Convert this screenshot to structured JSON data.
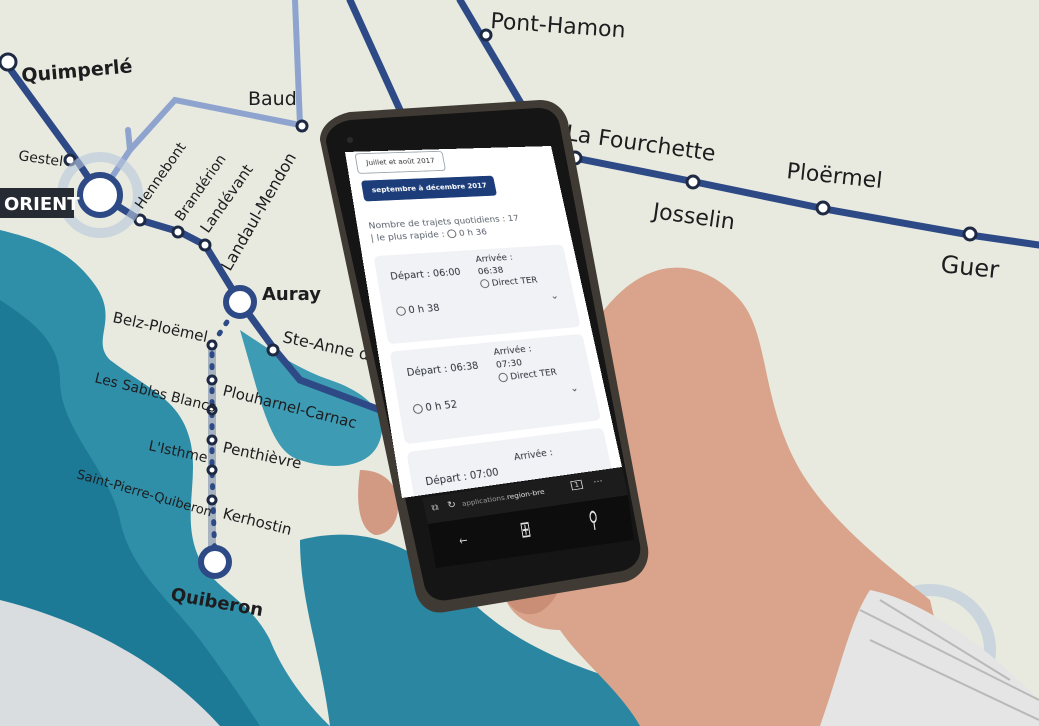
{
  "map": {
    "stations": {
      "pont_hamon": "Pont-Hamon",
      "quimperle": "Quimperlé",
      "baud": "Baud",
      "gestel": "Gestel",
      "hennebont": "Hennebont",
      "branderion": "Brandérion",
      "landevant": "Landévant",
      "landaul_mendon": "Landaul-Mendon",
      "lorient": "ORIENT",
      "auray": "Auray",
      "ste_anne": "Ste-Anne d'A",
      "belz": "Belz-Ploëmel",
      "plouharnel": "Plouharnel-Carnac",
      "les_sables": "Les Sables Blancs",
      "penthievre": "Penthièvre",
      "isthme": "L'Isthme",
      "st_pierre": "Saint-Pierre-Quiberon",
      "kerhostin": "Kerhostin",
      "quiberon": "Quiberon",
      "la_fourchette": "La Fourchette",
      "ploermel": "Ploërmel",
      "josselin": "Josselin",
      "guer": "Guer"
    },
    "colors": {
      "line": "#2e4a86",
      "line_light": "#7d95c4",
      "sea": "#2f8ea8",
      "land": "#e9ebe0",
      "label": "#1d1d1f"
    }
  },
  "phone": {
    "tabs": {
      "summer": "Juillet et août 2017",
      "active": "septembre à décembre 2017"
    },
    "summary": {
      "line1": "Nombre de trajets quotidiens : 17",
      "line2_prefix": "| le plus rapide :",
      "fastest": "0 h 36"
    },
    "trips": [
      {
        "depart": "Départ : 06:00",
        "arrival_label": "Arrivée :",
        "arrival": "06:38",
        "mode": "Direct TER",
        "duration": "0 h 38"
      },
      {
        "depart": "Départ : 06:38",
        "arrival_label": "Arrivée :",
        "arrival": "07:30",
        "mode": "Direct TER",
        "duration": "0 h 52"
      },
      {
        "depart": "Départ : 07:00",
        "arrival_label": "Arrivée :",
        "arrival": "",
        "mode": "",
        "duration": ""
      }
    ],
    "browser": {
      "url_prefix": "applications.",
      "url_host": "region-bre",
      "tabs_count": "1",
      "more": "···"
    },
    "nav_icons": [
      "back-arrow-icon",
      "windows-logo-icon",
      "search-icon"
    ]
  }
}
